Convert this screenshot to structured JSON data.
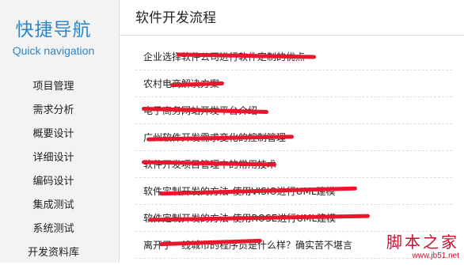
{
  "sidebar": {
    "title": "快捷导航",
    "subtitle": "Quick navigation",
    "items": [
      {
        "label": "项目管理"
      },
      {
        "label": "需求分析"
      },
      {
        "label": "概要设计"
      },
      {
        "label": "详细设计"
      },
      {
        "label": "编码设计"
      },
      {
        "label": "集成测试"
      },
      {
        "label": "系统测试"
      },
      {
        "label": "开发资料库"
      }
    ]
  },
  "main": {
    "title": "软件开发流程",
    "articles": [
      {
        "title": "企业选择软件公司进行软件定制的优点"
      },
      {
        "title": "农村电商解决方案"
      },
      {
        "title": "电子商务网站开发平台介绍"
      },
      {
        "title": "广州软件开发需求变化的控制管理"
      },
      {
        "title": "软件开发项目管理中的常用技术"
      },
      {
        "title": "软件定制开发的方法-使用VISIO进行UML建模"
      },
      {
        "title": "软件定制开发的方法-使用ROSE进行UML建模"
      },
      {
        "title": "离开了一线城市的程序员是什么样？确实苦不堪言"
      }
    ]
  },
  "watermark": {
    "text": "脚本之家",
    "url": "www.jb51.net"
  },
  "colors": {
    "accent": "#2f86c8",
    "redaction": "#e8172e",
    "watermark": "#c8102e"
  }
}
